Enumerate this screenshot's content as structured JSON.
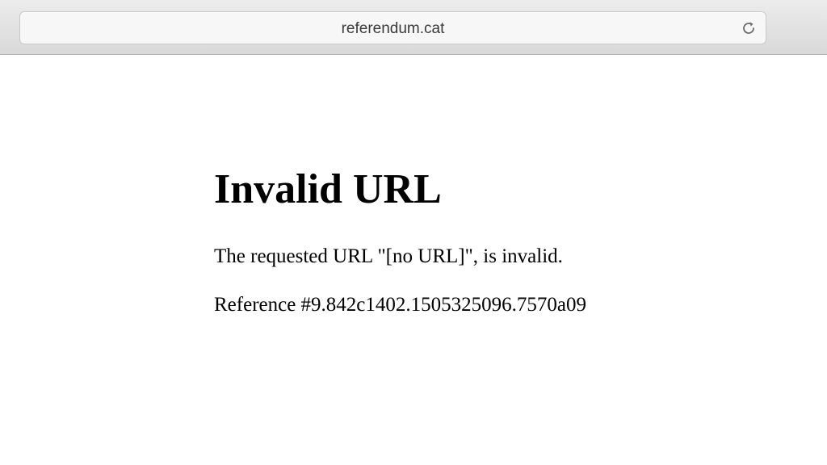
{
  "browser": {
    "url": "referendum.cat",
    "reload_icon": "reload-icon"
  },
  "page": {
    "title": "Invalid URL",
    "message": "The requested URL \"[no URL]\", is invalid.",
    "reference": "Reference #9.842c1402.1505325096.7570a09"
  }
}
